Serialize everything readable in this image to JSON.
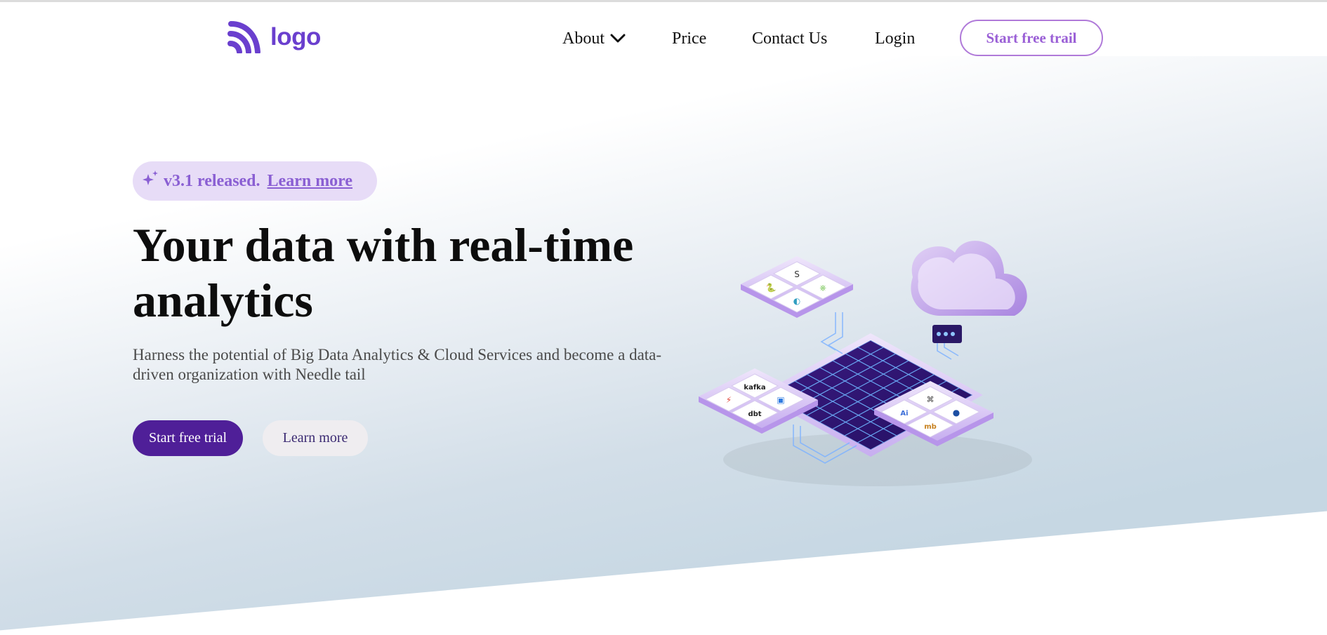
{
  "brand": {
    "logo_text": "logo",
    "logo_color": "#6a3fce"
  },
  "nav": {
    "items": [
      {
        "label": "About",
        "has_dropdown": true,
        "icon": "chevron-down-icon"
      },
      {
        "label": "Price"
      },
      {
        "label": "Contact Us"
      },
      {
        "label": "Login"
      }
    ],
    "cta_label": "Start free trail"
  },
  "hero": {
    "badge_text": "v3.1 released.",
    "badge_link": "Learn more",
    "badge_icon": "sparkle-icon",
    "headline_line1": "Your data with real-time",
    "headline_line2": "analytics",
    "subtext": "Harness the potential of Big Data Analytics & Cloud Services and become a data-driven organization with Needle tail",
    "primary_button": "Start free trial",
    "secondary_button": "Learn more"
  },
  "illustration": {
    "logos": [
      "S",
      "🐍",
      "⎈",
      "◐",
      "kafka",
      "▣",
      "⚡",
      "dbt",
      "⌘",
      "●",
      "Ai",
      "mb"
    ]
  },
  "colors": {
    "primary": "#4f1f98",
    "accent": "#9a5fd6",
    "badge_bg": "#e7dcf7",
    "hero_gradient_end": "#c5d6e2"
  }
}
